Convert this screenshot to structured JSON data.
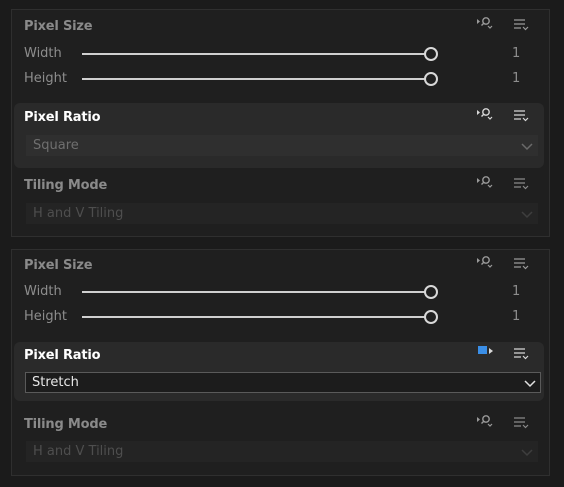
{
  "panels": [
    {
      "pixel_size": {
        "title": "Pixel Size",
        "width_label": "Width",
        "width_value": "1",
        "height_label": "Height",
        "height_value": "1"
      },
      "pixel_ratio": {
        "title": "Pixel Ratio",
        "value": "Square",
        "state": "disabled"
      },
      "tiling_mode": {
        "title": "Tiling Mode",
        "value": "H and V Tiling",
        "state": "disabled"
      }
    },
    {
      "pixel_size": {
        "title": "Pixel Size",
        "width_label": "Width",
        "width_value": "1",
        "height_label": "Height",
        "height_value": "1"
      },
      "pixel_ratio": {
        "title": "Pixel Ratio",
        "value": "Stretch",
        "state": "active"
      },
      "tiling_mode": {
        "title": "Tiling Mode",
        "value": "H and V Tiling",
        "state": "disabled"
      }
    }
  ],
  "icons": {
    "source": "expose-parameter-icon",
    "source_active": "parameter-connected-icon",
    "menu": "options-menu-icon"
  },
  "colors": {
    "active_icon_blue": "#3a8ee6",
    "title_dim": "#8a8a8a",
    "title_bright": "#ffffff"
  }
}
